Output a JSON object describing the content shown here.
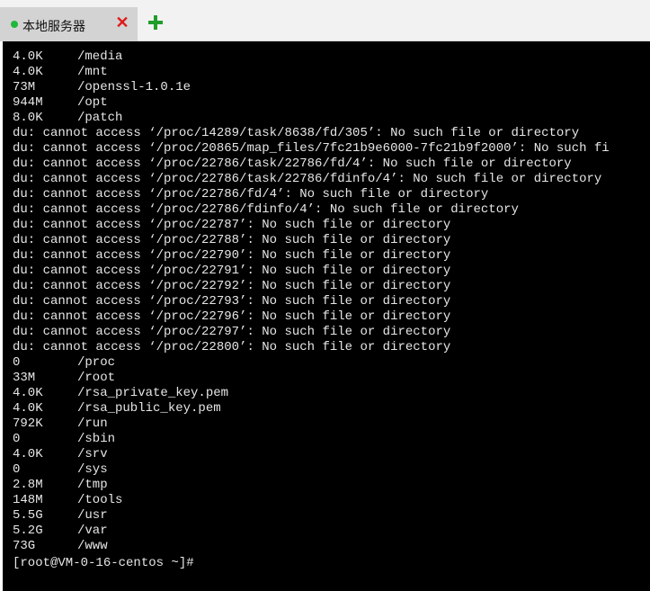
{
  "tab": {
    "label": "本地服务器",
    "close_glyph": "✕",
    "status_color": "#1fb83a",
    "status_icon": "status-dot-icon",
    "add_icon": "plus-icon"
  },
  "terminal": {
    "lines": [
      {
        "size": "4.0K",
        "path": "/media"
      },
      {
        "size": "4.0K",
        "path": "/mnt"
      },
      {
        "size": "73M",
        "path": "/openssl-1.0.1e"
      },
      {
        "size": "944M",
        "path": "/opt"
      },
      {
        "size": "8.0K",
        "path": "/patch"
      },
      {
        "text": "du: cannot access ‘/proc/14289/task/8638/fd/305’: No such file or directory"
      },
      {
        "text": "du: cannot access ‘/proc/20865/map_files/7fc21b9e6000-7fc21b9f2000’: No such fi"
      },
      {
        "text": "du: cannot access ‘/proc/22786/task/22786/fd/4’: No such file or directory"
      },
      {
        "text": "du: cannot access ‘/proc/22786/task/22786/fdinfo/4’: No such file or directory"
      },
      {
        "text": "du: cannot access ‘/proc/22786/fd/4’: No such file or directory"
      },
      {
        "text": "du: cannot access ‘/proc/22786/fdinfo/4’: No such file or directory"
      },
      {
        "text": "du: cannot access ‘/proc/22787’: No such file or directory"
      },
      {
        "text": "du: cannot access ‘/proc/22788’: No such file or directory"
      },
      {
        "text": "du: cannot access ‘/proc/22790’: No such file or directory"
      },
      {
        "text": "du: cannot access ‘/proc/22791’: No such file or directory"
      },
      {
        "text": "du: cannot access ‘/proc/22792’: No such file or directory"
      },
      {
        "text": "du: cannot access ‘/proc/22793’: No such file or directory"
      },
      {
        "text": "du: cannot access ‘/proc/22796’: No such file or directory"
      },
      {
        "text": "du: cannot access ‘/proc/22797’: No such file or directory"
      },
      {
        "text": "du: cannot access ‘/proc/22800’: No such file or directory"
      },
      {
        "size": "0",
        "path": "/proc"
      },
      {
        "size": "33M",
        "path": "/root"
      },
      {
        "size": "4.0K",
        "path": "/rsa_private_key.pem"
      },
      {
        "size": "4.0K",
        "path": "/rsa_public_key.pem"
      },
      {
        "size": "792K",
        "path": "/run"
      },
      {
        "size": "0",
        "path": "/sbin"
      },
      {
        "size": "4.0K",
        "path": "/srv"
      },
      {
        "size": "0",
        "path": "/sys"
      },
      {
        "size": "2.8M",
        "path": "/tmp"
      },
      {
        "size": "148M",
        "path": "/tools"
      },
      {
        "size": "5.5G",
        "path": "/usr"
      },
      {
        "size": "5.2G",
        "path": "/var"
      },
      {
        "size": "73G",
        "path": "/www"
      }
    ],
    "prompt": "[root@VM-0-16-centos ~]#",
    "background": "#000000",
    "foreground": "#e6e6e6"
  }
}
